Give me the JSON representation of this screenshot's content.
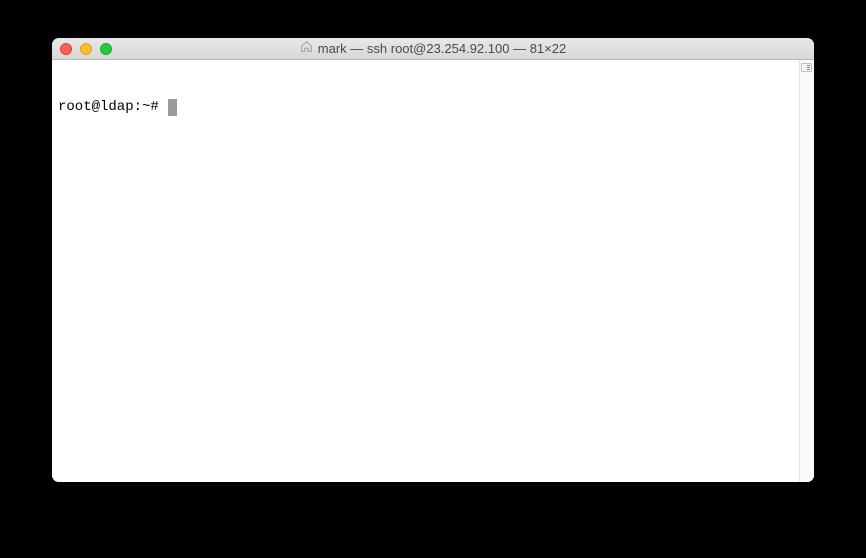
{
  "window": {
    "title": "mark — ssh root@23.254.92.100 — 81×22"
  },
  "terminal": {
    "prompt": "root@ldap:~# "
  },
  "colors": {
    "close": "#ff5f57",
    "minimize": "#ffbd2e",
    "zoom": "#28c840"
  }
}
